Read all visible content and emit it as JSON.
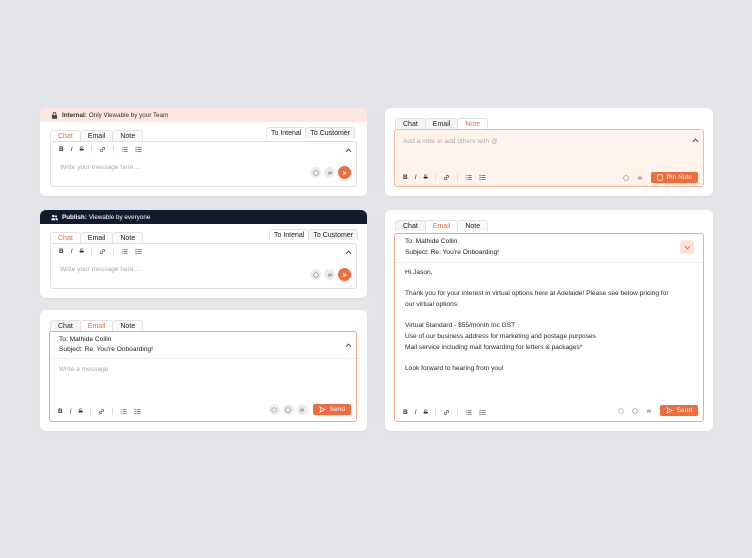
{
  "tabs": {
    "chat": "Chat",
    "email": "Email",
    "note": "Note"
  },
  "internal_card": {
    "banner_bold": "Internal:",
    "banner_text": "Only Viewable by your Team",
    "to_internal": "To Intenal",
    "to_customer": "To Customer",
    "placeholder": "Write your message here..."
  },
  "publish_card": {
    "banner_bold": "Publish:",
    "banner_text": "Viewable by everyone",
    "to_internal": "To Intenal",
    "to_customer": "To Customer",
    "placeholder": "Write your message here..."
  },
  "email_small": {
    "to": "To: Mathide Collin",
    "subject": "Subject: Re: You're Onboarding!",
    "placeholder": "Write a message",
    "send": "Send"
  },
  "note_card": {
    "placeholder": "Add a note or add others with @",
    "pin": "Pin Note"
  },
  "email_large": {
    "to": "To: Mathide Collin",
    "subject": "Subject: Re: You're Onboarding!",
    "greeting": "Hi Jason,",
    "line1": "Thank you for your interest in virtual options here at Adelaide! Please see below pricing for",
    "line2": "our virtual options:",
    "line3": "Virtual Standard - $55/month Inc GST",
    "line4": "Use of our business address for marketing and postage purposes",
    "line5": "Mail service including mail forwarding for letters & packages*",
    "line6": "Look forward to hearing from you!",
    "send": "Send"
  },
  "toolbar": {
    "bold": "B",
    "italic": "I",
    "strike": "S"
  },
  "colors": {
    "accent": "#f26b3a",
    "background": "#e4e5e9",
    "internal_banner": "#fde8df",
    "publish_banner": "#141a2e"
  },
  "icons": [
    "lock-icon",
    "users-icon",
    "link-icon",
    "ordered-list-icon",
    "bullet-list-icon",
    "chevron-up-icon",
    "chevron-down-icon",
    "emoji-icon",
    "hash-icon",
    "send-icon",
    "attach-icon",
    "note-icon"
  ]
}
